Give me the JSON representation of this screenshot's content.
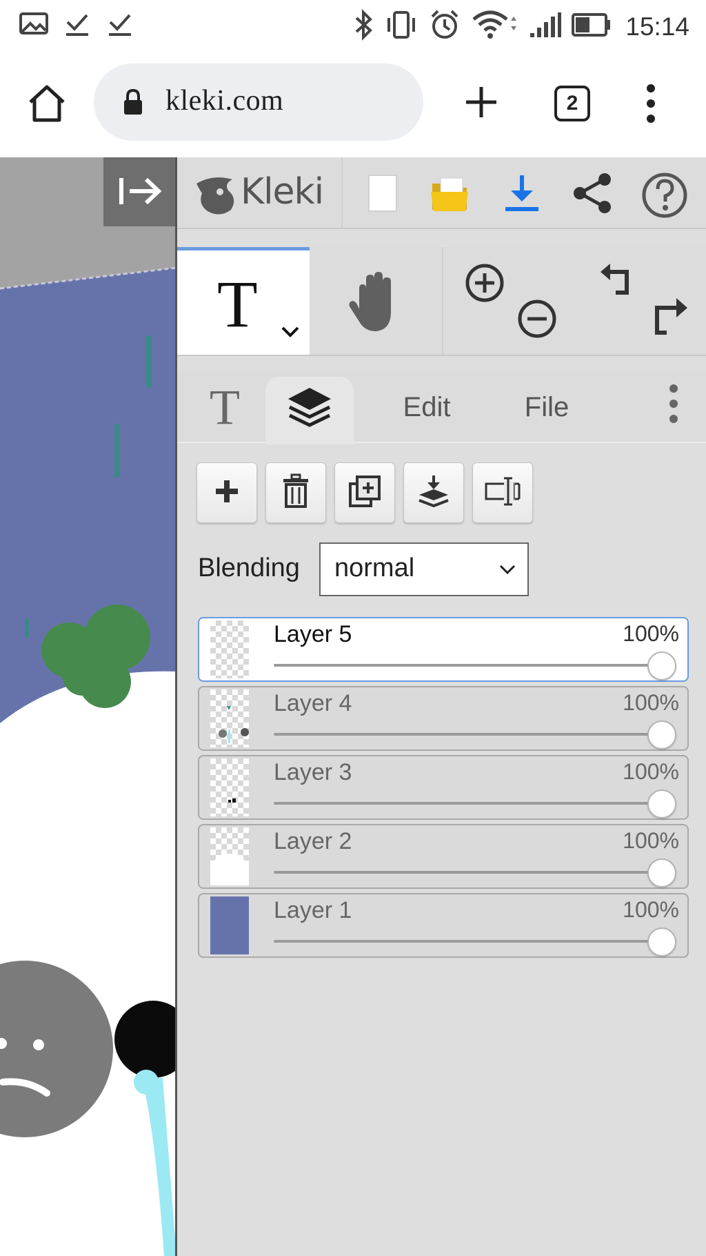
{
  "status_bar": {
    "time": "15:14",
    "left_icons": [
      "gallery-icon",
      "check-icon",
      "check-icon"
    ],
    "right_icons": [
      "bluetooth-icon",
      "vibrate-icon",
      "alarm-icon",
      "wifi-icon",
      "signal-icon",
      "battery-icon"
    ]
  },
  "browser": {
    "url": "kleki.com",
    "tab_count": "2"
  },
  "app": {
    "logo_text": "Kleki",
    "top_icons": [
      "new-file-icon",
      "open-folder-icon",
      "download-icon",
      "share-icon",
      "help-icon"
    ],
    "tools": {
      "text_tool_glyph": "T"
    },
    "tabs": {
      "text_glyph": "T",
      "edit_label": "Edit",
      "file_label": "File"
    },
    "blending": {
      "label": "Blending",
      "value": "normal"
    },
    "layers": [
      {
        "name": "Layer 5",
        "opacity": "100%",
        "active": true
      },
      {
        "name": "Layer 4",
        "opacity": "100%",
        "active": false
      },
      {
        "name": "Layer 3",
        "opacity": "100%",
        "active": false
      },
      {
        "name": "Layer 2",
        "opacity": "100%",
        "active": false
      },
      {
        "name": "Layer 1",
        "opacity": "100%",
        "active": false
      }
    ]
  },
  "colors": {
    "accent_blue": "#6a9be0",
    "canvas_blue": "#6673ab",
    "panel_bg": "#dedede",
    "download_blue": "#1a73e8",
    "folder_yellow": "#f5c518"
  }
}
